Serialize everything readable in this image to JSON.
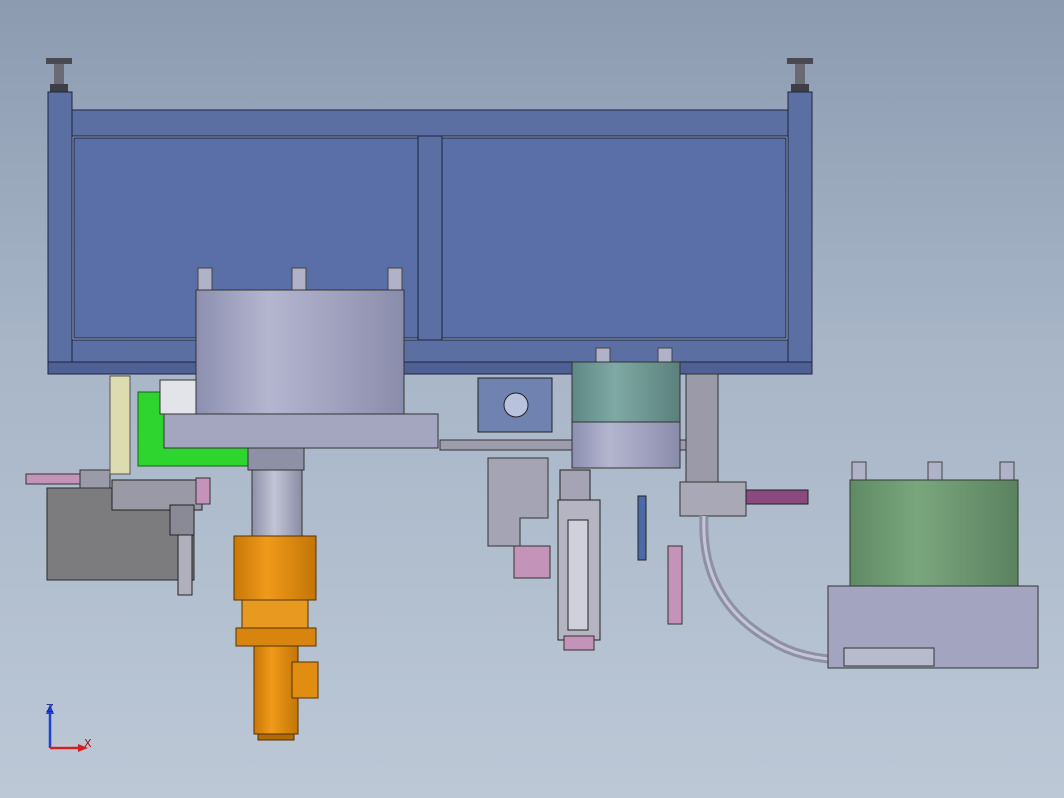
{
  "triad": {
    "z_label": "Z",
    "x_label": "X"
  },
  "colors": {
    "frame": "#5b6fa3",
    "panel": "#5a6ea8",
    "housing": "#a2a4c0",
    "green_cylinder": "#6e9a72",
    "teal_cylinder": "#6f9c98",
    "motor": "#e08d12",
    "bright_green": "#2fd52f",
    "pink_part": "#c493b9",
    "gray_block": "#7c7c7e",
    "axis_z": "#2040d0",
    "axis_x": "#d02020"
  }
}
